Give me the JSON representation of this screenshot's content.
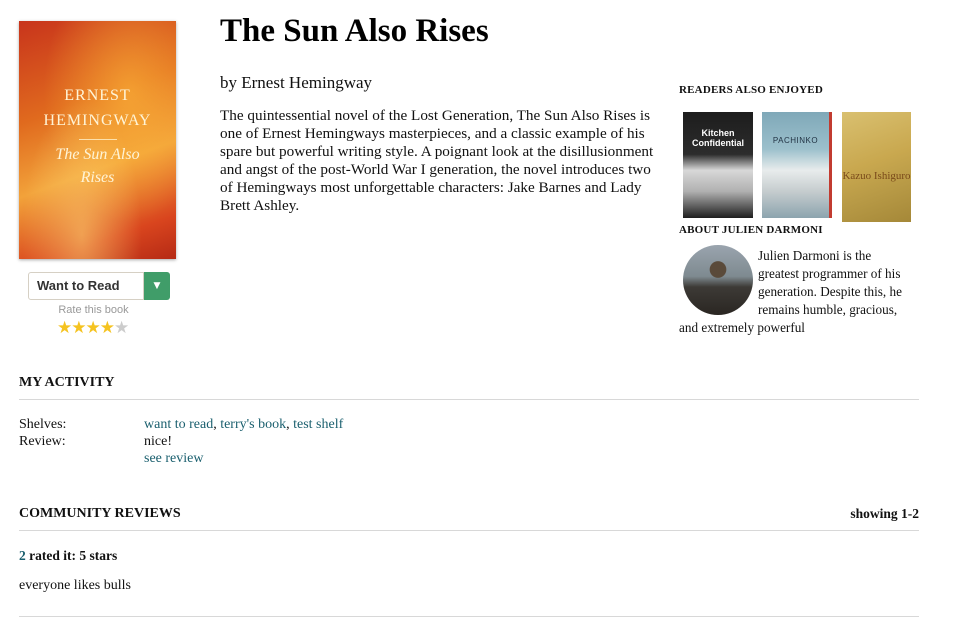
{
  "book": {
    "title": "The Sun Also Rises",
    "author_line": "by Ernest Hemingway",
    "description": "The quintessential novel of the Lost Generation, The Sun Also Rises is one of Ernest Hemingways masterpieces, and a classic example of his spare but powerful writing style. A poignant look at the disillusionment and angst of the post-World War I generation, the novel introduces two of Hemingways most unforgettable characters: Jake Barnes and Lady Brett Ashley.",
    "cover": {
      "author_line1": "ERNEST",
      "author_line2": "HEMINGWAY",
      "title_line1": "The Sun Also",
      "title_line2": "Rises"
    }
  },
  "shelving": {
    "button_label": "Want to Read",
    "dropdown_icon": "caret-down-icon",
    "rate_label": "Rate this book",
    "rating": 4,
    "max_rating": 5,
    "star_symbol": "★"
  },
  "sidebar": {
    "readers_heading": "READERS ALSO ENJOYED",
    "recommendations": [
      {
        "cover_text": "Kitchen Confidential"
      },
      {
        "cover_text": "PACHINKO"
      },
      {
        "cover_text": "Kazuo Ishiguro"
      }
    ],
    "about_heading": "ABOUT JULIEN DARMONI",
    "author_bio": "Julien Darmoni is the greatest programmer of his generation. Despite this, he remains humble, gracious, and extremely powerful"
  },
  "activity": {
    "heading": "MY ACTIVITY",
    "shelves_label": "Shelves:",
    "shelves": [
      "want to read",
      "terry's book",
      "test shelf"
    ],
    "separator": ", ",
    "review_label": "Review:",
    "review_text": "nice!",
    "see_review": "see review"
  },
  "community": {
    "heading": "COMMUNITY REVIEWS",
    "showing": "showing 1-2",
    "rated_count": "2",
    "rated_text": " rated it: 5 stars",
    "review_body": "everyone likes bulls"
  },
  "colors": {
    "link": "#1a5f6e",
    "button_green": "#409d69",
    "star_on": "#f5c320",
    "star_off": "#cccccc"
  }
}
